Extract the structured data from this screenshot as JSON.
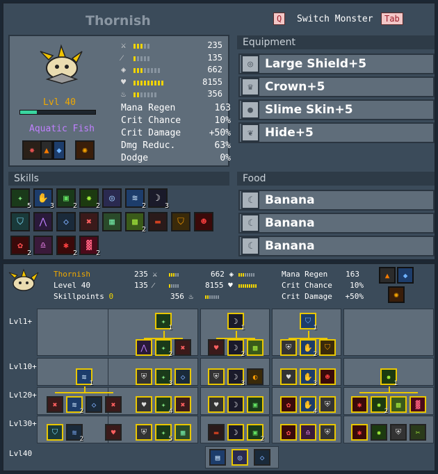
{
  "window": {
    "title": "Thornish"
  },
  "switch": {
    "key_q": "Q",
    "label": "Switch Monster",
    "key_tab": "Tab"
  },
  "monster": {
    "level": "Lvl 40",
    "type": "Aquatic Fish",
    "xp_fraction": 0.22,
    "stats": [
      {
        "icon": "sword-icon",
        "value": "235",
        "bars_filled": 3,
        "bars_total": 5
      },
      {
        "icon": "staff-icon",
        "value": "135",
        "bars_filled": 1,
        "bars_total": 5
      },
      {
        "icon": "shield-icon",
        "value": "662",
        "bars_filled": 3,
        "bars_total": 8
      },
      {
        "icon": "heart-icon",
        "value": "8155",
        "bars_filled": 9,
        "bars_total": 9
      },
      {
        "icon": "mana-icon",
        "value": "356",
        "bars_filled": 2,
        "bars_total": 7
      }
    ],
    "text_stats": [
      {
        "label": "Mana Regen",
        "value": "163"
      },
      {
        "label": "Crit Chance",
        "value": "10%"
      },
      {
        "label": "Crit Damage",
        "value": "+50%"
      },
      {
        "label": "Dmg Reduc.",
        "value": "63%"
      },
      {
        "label": "Dodge",
        "value": "0%"
      }
    ]
  },
  "equipment": {
    "header": "Equipment",
    "items": [
      {
        "icon": "shield-icon",
        "label": "Large Shield+5"
      },
      {
        "icon": "crown-icon",
        "label": "Crown+5"
      },
      {
        "icon": "slime-icon",
        "label": "Slime Skin+5"
      },
      {
        "icon": "hide-icon",
        "label": "Hide+5"
      }
    ]
  },
  "skills": {
    "header": "Skills",
    "counts": [
      "5",
      "3",
      "2",
      "2",
      "",
      "2",
      "3",
      "",
      "",
      "",
      "",
      "",
      "2",
      "",
      "",
      "",
      "2",
      "",
      "2",
      "2",
      "",
      ""
    ]
  },
  "food": {
    "header": "Food",
    "items": [
      {
        "icon": "banana-icon",
        "label": "Banana"
      },
      {
        "icon": "banana-icon",
        "label": "Banana"
      },
      {
        "icon": "banana-icon",
        "label": "Banana"
      }
    ]
  },
  "skilltree": {
    "name": "Thornish",
    "level": "Level 40",
    "skillpoints_label": "Skillpoints",
    "skillpoints_value": "0",
    "atk": "235",
    "mag": "135",
    "def": "662",
    "hp": "8155",
    "mana": "356",
    "mana_regen_label": "Mana Regen",
    "mana_regen": "163",
    "crit_chance_label": "Crit Chance",
    "crit_chance": "10%",
    "crit_damage_label": "Crit Damage",
    "crit_damage": "+50%",
    "level_labels": [
      "Lvl1+",
      "Lvl10+",
      "Lvl20+",
      "Lvl30+",
      "Lvl40"
    ]
  },
  "colors": {
    "accent": "#e9c700",
    "panel": "#3b4b5a",
    "box": "#5f6d7a",
    "level_text": "#f1a900",
    "type_text": "#c080ff"
  }
}
